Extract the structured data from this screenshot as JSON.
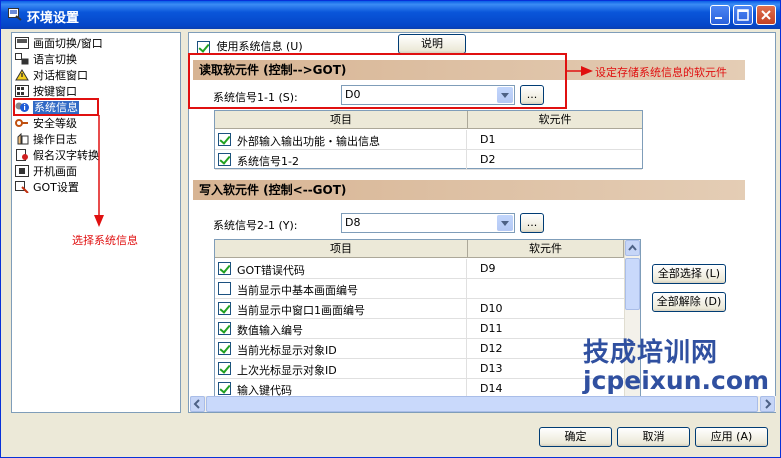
{
  "window": {
    "title": "环境设置"
  },
  "tree": {
    "items": [
      {
        "label": "画面切换/窗口",
        "icon": "screen-switch-icon"
      },
      {
        "label": "语言切换",
        "icon": "language-icon"
      },
      {
        "label": "对话框窗口",
        "icon": "dialog-icon"
      },
      {
        "label": "按键窗口",
        "icon": "keypad-icon"
      },
      {
        "label": "系统信息",
        "icon": "system-info-icon",
        "selected": true
      },
      {
        "label": "安全等级",
        "icon": "security-icon"
      },
      {
        "label": "操作日志",
        "icon": "log-icon"
      },
      {
        "label": "假名汉字转换",
        "icon": "kana-kanji-icon"
      },
      {
        "label": "开机画面",
        "icon": "startup-icon"
      },
      {
        "label": "GOT设置",
        "icon": "got-settings-icon"
      }
    ]
  },
  "annotations": {
    "select_system_info": "选择系统信息",
    "set_device": "设定存储系统信息的软元件"
  },
  "panel": {
    "use_system_info_label": "使用系统信息 (U)",
    "use_system_info_checked": true,
    "explain_button": "说明",
    "read": {
      "title": "读取软元件 (控制-->GOT)",
      "signal_label": "系统信号1-1 (S):",
      "signal_value": "D0",
      "browse": "...",
      "col_item": "项目",
      "col_device": "软元件",
      "rows": [
        {
          "item": "外部输入输出功能・输出信息",
          "device": "D1",
          "checked": true
        },
        {
          "item": "系统信号1-2",
          "device": "D2",
          "checked": true
        }
      ]
    },
    "write": {
      "title": "写入软元件 (控制<--GOT)",
      "signal_label": "系统信号2-1 (Y):",
      "signal_value": "D8",
      "browse": "...",
      "col_item": "项目",
      "col_device": "软元件",
      "rows": [
        {
          "item": "GOT错误代码",
          "device": "D9",
          "checked": true
        },
        {
          "item": "当前显示中基本画面编号",
          "device": "",
          "checked": false
        },
        {
          "item": "当前显示中窗口1画面编号",
          "device": "D10",
          "checked": true
        },
        {
          "item": "数值输入编号",
          "device": "D11",
          "checked": true
        },
        {
          "item": "当前光标显示对象ID",
          "device": "D12",
          "checked": true
        },
        {
          "item": "上次光标显示对象ID",
          "device": "D13",
          "checked": true
        },
        {
          "item": "输入键代码",
          "device": "D14",
          "checked": true
        }
      ],
      "select_all": "全部选择 (L)",
      "clear_all": "全部解除 (D)"
    }
  },
  "footer": {
    "ok": "确定",
    "cancel": "取消",
    "apply": "应用 (A)"
  },
  "watermark": {
    "line1": "技成培训网",
    "line2": "jcpeixun.com"
  }
}
